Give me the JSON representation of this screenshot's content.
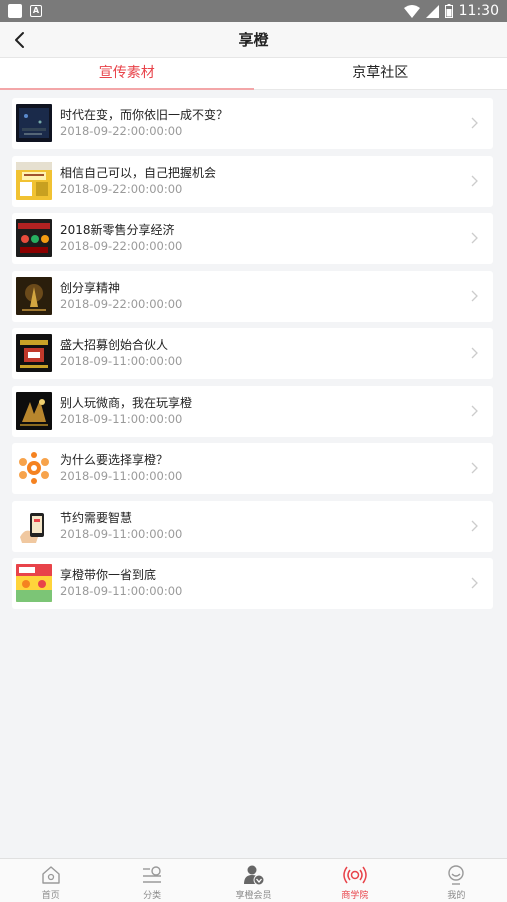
{
  "statusbar": {
    "time": "11:30"
  },
  "navbar": {
    "title": "享橙"
  },
  "tabs": [
    {
      "label": "宣传素材",
      "active": true
    },
    {
      "label": "京草社区",
      "active": false
    }
  ],
  "articles": [
    {
      "title": "时代在变，而你依旧一成不变？",
      "date": "2018-09-22:00:00:00",
      "thumb": "dark-blue"
    },
    {
      "title": "相信自己可以，自己把握机会",
      "date": "2018-09-22:00:00:00",
      "thumb": "yellow-poster"
    },
    {
      "title": "2018新零售分享经济",
      "date": "2018-09-22:00:00:00",
      "thumb": "dark-red"
    },
    {
      "title": "创分享精神",
      "date": "2018-09-22:00:00:00",
      "thumb": "dark-gold"
    },
    {
      "title": "盛大招募创始合伙人",
      "date": "2018-09-11:00:00:00",
      "thumb": "black-gold-red"
    },
    {
      "title": "别人玩微商，我在玩享橙",
      "date": "2018-09-11:00:00:00",
      "thumb": "black-gold"
    },
    {
      "title": "为什么要选择享橙？",
      "date": "2018-09-11:00:00:00",
      "thumb": "orange-circles"
    },
    {
      "title": "节约需要智慧",
      "date": "2018-09-11:00:00:00",
      "thumb": "phone-hand"
    },
    {
      "title": "享橙带你一省到底",
      "date": "2018-09-11:00:00:00",
      "thumb": "red-yellow-banner"
    }
  ],
  "tabbar": [
    {
      "label": "首页",
      "icon": "home-icon",
      "active": false
    },
    {
      "label": "分类",
      "icon": "category-icon",
      "active": false
    },
    {
      "label": "享橙会员",
      "icon": "member-icon",
      "active": false
    },
    {
      "label": "商学院",
      "icon": "broadcast-icon",
      "active": true
    },
    {
      "label": "我的",
      "icon": "profile-icon",
      "active": false
    }
  ],
  "colors": {
    "accent": "#e8434a",
    "background": "#f3f4f6"
  }
}
